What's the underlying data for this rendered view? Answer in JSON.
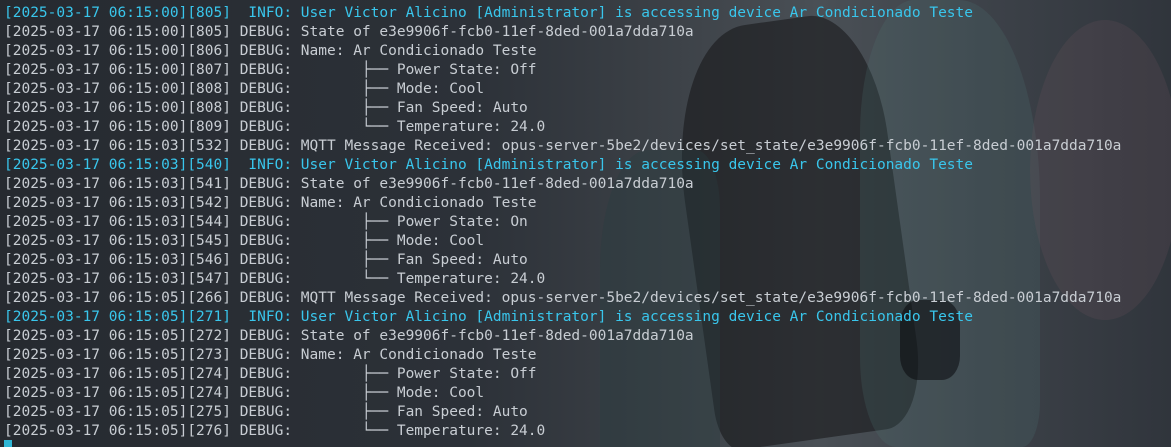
{
  "colors": {
    "default_text": "#c8cdd3",
    "info_text": "#39c6ec",
    "cursor": "#2fb7d6"
  },
  "log_lines": [
    {
      "level": "info",
      "text": "[2025-03-17 06:15:00][805]  INFO: User Victor Alicino [Administrator] is accessing device Ar Condicionado Teste"
    },
    {
      "level": "debug",
      "text": "[2025-03-17 06:15:00][805] DEBUG: State of e3e9906f-fcb0-11ef-8ded-001a7dda710a"
    },
    {
      "level": "debug",
      "text": "[2025-03-17 06:15:00][806] DEBUG: Name: Ar Condicionado Teste"
    },
    {
      "level": "debug",
      "text": "[2025-03-17 06:15:00][807] DEBUG:        ├── Power State: Off"
    },
    {
      "level": "debug",
      "text": "[2025-03-17 06:15:00][808] DEBUG:        ├── Mode: Cool"
    },
    {
      "level": "debug",
      "text": "[2025-03-17 06:15:00][808] DEBUG:        ├── Fan Speed: Auto"
    },
    {
      "level": "debug",
      "text": "[2025-03-17 06:15:00][809] DEBUG:        └── Temperature: 24.0"
    },
    {
      "level": "debug",
      "text": "[2025-03-17 06:15:03][532] DEBUG: MQTT Message Received: opus-server-5be2/devices/set_state/e3e9906f-fcb0-11ef-8ded-001a7dda710a"
    },
    {
      "level": "info",
      "text": "[2025-03-17 06:15:03][540]  INFO: User Victor Alicino [Administrator] is accessing device Ar Condicionado Teste"
    },
    {
      "level": "debug",
      "text": "[2025-03-17 06:15:03][541] DEBUG: State of e3e9906f-fcb0-11ef-8ded-001a7dda710a"
    },
    {
      "level": "debug",
      "text": "[2025-03-17 06:15:03][542] DEBUG: Name: Ar Condicionado Teste"
    },
    {
      "level": "debug",
      "text": "[2025-03-17 06:15:03][544] DEBUG:        ├── Power State: On"
    },
    {
      "level": "debug",
      "text": "[2025-03-17 06:15:03][545] DEBUG:        ├── Mode: Cool"
    },
    {
      "level": "debug",
      "text": "[2025-03-17 06:15:03][546] DEBUG:        ├── Fan Speed: Auto"
    },
    {
      "level": "debug",
      "text": "[2025-03-17 06:15:03][547] DEBUG:        └── Temperature: 24.0"
    },
    {
      "level": "debug",
      "text": "[2025-03-17 06:15:05][266] DEBUG: MQTT Message Received: opus-server-5be2/devices/set_state/e3e9906f-fcb0-11ef-8ded-001a7dda710a"
    },
    {
      "level": "info",
      "text": "[2025-03-17 06:15:05][271]  INFO: User Victor Alicino [Administrator] is accessing device Ar Condicionado Teste"
    },
    {
      "level": "debug",
      "text": "[2025-03-17 06:15:05][272] DEBUG: State of e3e9906f-fcb0-11ef-8ded-001a7dda710a"
    },
    {
      "level": "debug",
      "text": "[2025-03-17 06:15:05][273] DEBUG: Name: Ar Condicionado Teste"
    },
    {
      "level": "debug",
      "text": "[2025-03-17 06:15:05][274] DEBUG:        ├── Power State: Off"
    },
    {
      "level": "debug",
      "text": "[2025-03-17 06:15:05][274] DEBUG:        ├── Mode: Cool"
    },
    {
      "level": "debug",
      "text": "[2025-03-17 06:15:05][275] DEBUG:        ├── Fan Speed: Auto"
    },
    {
      "level": "debug",
      "text": "[2025-03-17 06:15:05][276] DEBUG:        └── Temperature: 24.0"
    }
  ]
}
